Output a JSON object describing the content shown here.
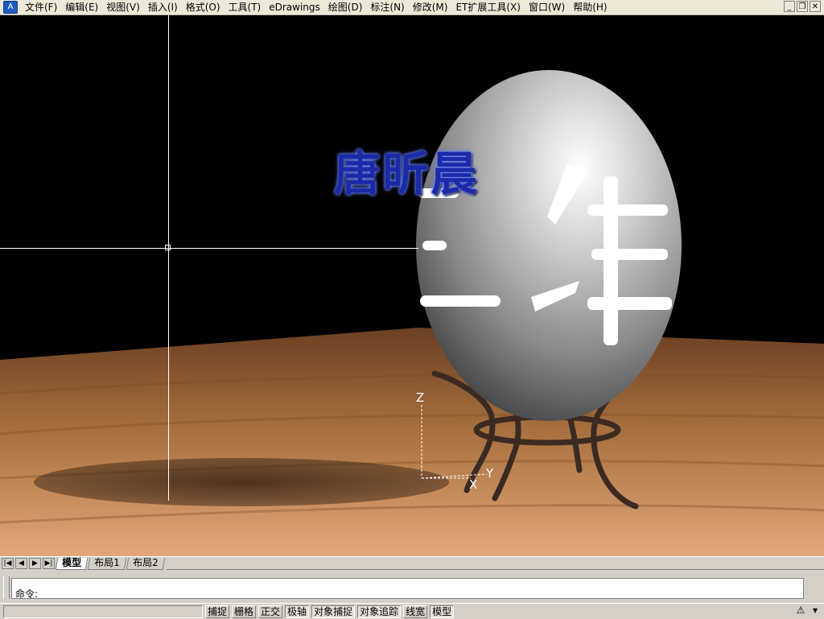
{
  "menubar": {
    "items": [
      "文件(F)",
      "编辑(E)",
      "视图(V)",
      "插入(I)",
      "格式(O)",
      "工具(T)",
      "eDrawings",
      "绘图(D)",
      "标注(N)",
      "修改(M)",
      "ET扩展工具(X)",
      "窗口(W)",
      "帮助(H)"
    ],
    "window_controls": [
      "_",
      "❐",
      "✕"
    ]
  },
  "viewport": {
    "signature_text": "唐昕晨",
    "egg_text": "三维",
    "ucs": {
      "z": "Z",
      "x": "X",
      "y": "Y"
    }
  },
  "tabs": {
    "nav": [
      "|◀",
      "◀",
      "▶",
      "▶|"
    ],
    "items": [
      "模型",
      "布局1",
      "布局2"
    ],
    "active": "模型"
  },
  "command": {
    "prompt": "命令:"
  },
  "status": {
    "buttons": [
      {
        "label": "捕捉",
        "on": false
      },
      {
        "label": "栅格",
        "on": false
      },
      {
        "label": "正交",
        "on": false
      },
      {
        "label": "极轴",
        "on": true
      },
      {
        "label": "对象捕捉",
        "on": true
      },
      {
        "label": "对象追踪",
        "on": true
      },
      {
        "label": "线宽",
        "on": false
      },
      {
        "label": "模型",
        "on": true
      }
    ]
  },
  "colors": {
    "background": "#000000",
    "signature": "#1c2aa8",
    "floor": "#a8703e"
  }
}
